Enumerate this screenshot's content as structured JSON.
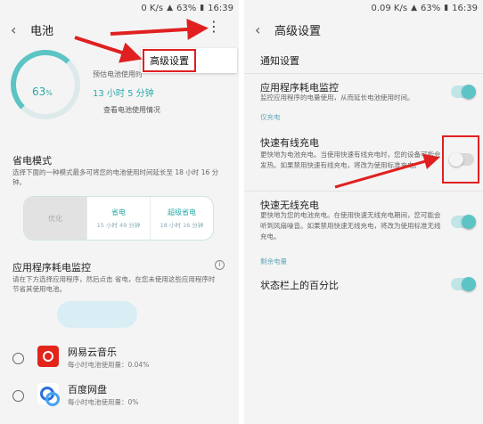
{
  "left": {
    "status": {
      "network": "0 K/s",
      "battery": "63%",
      "time": "16:39"
    },
    "title": "电池",
    "battery_percent": "63",
    "battery_unit": "%",
    "estimated_label": "预估电池使用时",
    "estimated_time": "13 小时 5 分钟",
    "usage_link": "查看电池使用情况",
    "menu_item": "高级设置",
    "power_mode": {
      "title": "省电模式",
      "desc": "选择下面的一种模式最多可将您的电池使用时间延长至 18 小时 16 分钟。",
      "modes": [
        {
          "name": "优化",
          "time": ""
        },
        {
          "name": "省电",
          "time": "15 小时 49 分钟"
        },
        {
          "name": "超级省电",
          "time": "18 小时 16 分钟"
        }
      ]
    },
    "monitor": {
      "title": "应用程序耗电监控",
      "info_icon": "i",
      "desc": "请在下方选择应用程序，然后点击 省电，在您未使用这些应用程序时节省其使用电池。"
    },
    "apps": [
      {
        "name": "网易云音乐",
        "usage": "每小时电池使用量：0.04%"
      },
      {
        "name": "百度网盘",
        "usage": "每小时电池使用量：0%"
      }
    ]
  },
  "right": {
    "status": {
      "network": "0.09 K/s",
      "battery": "63%",
      "time": "16:39"
    },
    "title": "高级设置",
    "notification": "通知设置",
    "app_monitor": {
      "title": "应用程序耗电监控",
      "desc": "监控应用程序的电量使用，从而延长电池使用时间。"
    },
    "cat_charging": "仅充电",
    "fast_wired": {
      "title": "快速有线充电",
      "desc": "更快地为电池充电。当使用快速有线充电时，您的设备可能会发热。如果禁用快速有线充电，将改为使用标准充电。"
    },
    "fast_wireless": {
      "title": "快速无线充电",
      "desc": "更快地为您的电池充电。在使用快速无线充电期间，您可能会听到风扇噪音。如果禁用快速无线充电，将改为使用标准无线充电。"
    },
    "cat_remaining": "剩余电量",
    "percentage": "状态栏上的百分比"
  },
  "colors": {
    "accent": "#5cc4c4",
    "highlight": "#e02020"
  },
  "icons": [
    "back-icon",
    "more-vert-icon",
    "info-icon",
    "netease-music-icon",
    "baidu-netdisk-icon"
  ]
}
